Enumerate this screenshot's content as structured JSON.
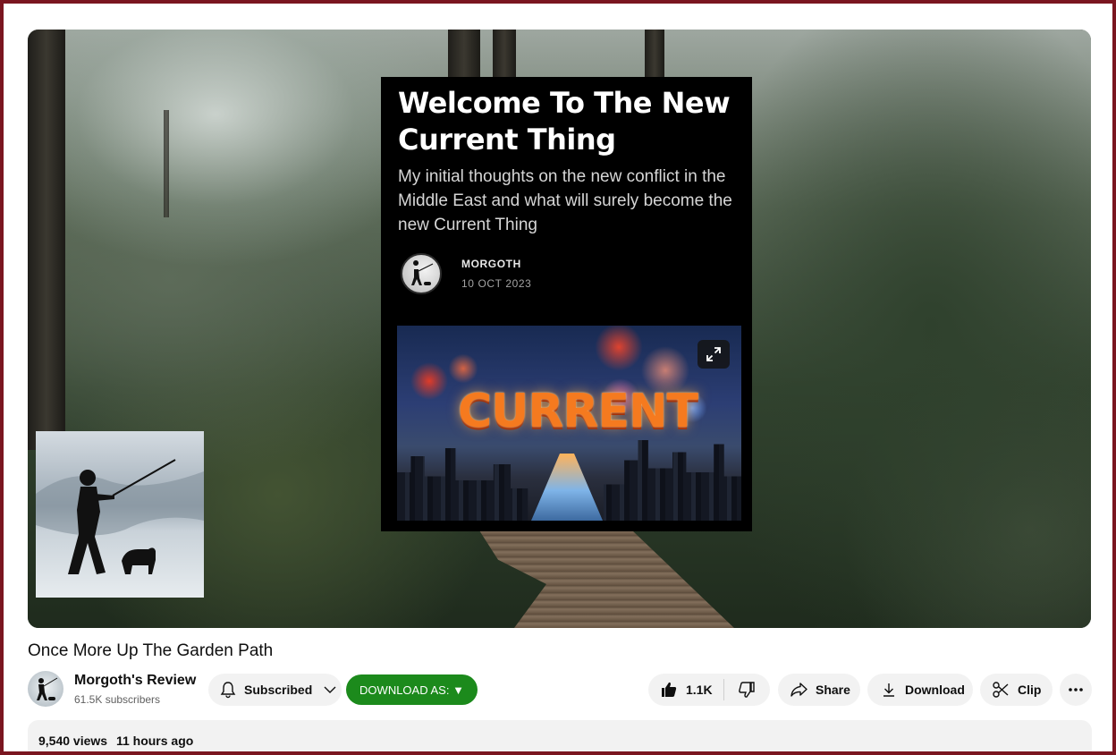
{
  "article": {
    "title": "Welcome To The New Current Thing",
    "subtitle": "My initial thoughts on the new conflict in the Middle East and what will surely become the new Current Thing",
    "author": "MORGOTH",
    "date": "10 OCT 2023",
    "image_text": "CURRENT"
  },
  "video": {
    "title": "Once More Up The Garden Path"
  },
  "channel": {
    "name": "Morgoth's Review",
    "subscribers": "61.5K subscribers"
  },
  "actions": {
    "subscribed_label": "Subscribed",
    "download_as_label": "DOWNLOAD AS: ▼",
    "like_count": "1.1K",
    "share_label": "Share",
    "download_label": "Download",
    "clip_label": "Clip"
  },
  "description": {
    "views": "9,540 views",
    "time": "11 hours ago"
  },
  "icons": {
    "subscribed": "bell-icon",
    "chevron": "chevron-down-icon",
    "like": "thumbs-up-icon",
    "dislike": "thumbs-down-icon",
    "share": "share-arrow-icon",
    "download": "download-icon",
    "clip": "scissors-icon",
    "more": "more-horizontal-icon",
    "expand": "expand-icon"
  },
  "colors": {
    "download_as_bg": "#1c8a1c",
    "frame_border": "#7a1620",
    "pill_bg": "#f2f2f2"
  }
}
